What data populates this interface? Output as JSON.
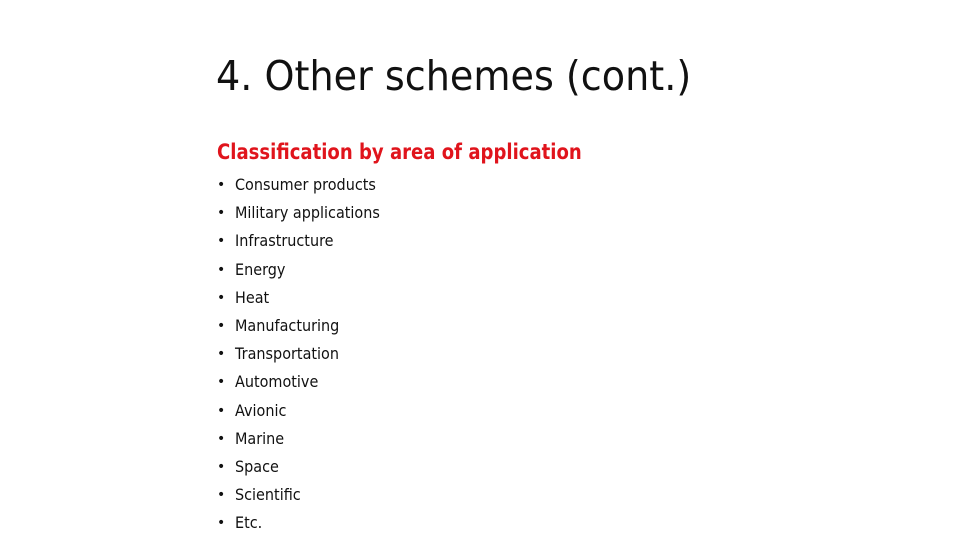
{
  "slide": {
    "title": "4. Other schemes (cont.)",
    "subtitle": "Classification by area of application",
    "accent_color": "#e0141c",
    "bullet_glyph": "•",
    "items": [
      "Consumer products",
      "Military applications",
      "Infrastructure",
      "Energy",
      "Heat",
      "Manufacturing",
      "Transportation",
      "Automotive",
      "Avionic",
      "Marine",
      "Space",
      "Scientific",
      "Etc."
    ]
  }
}
